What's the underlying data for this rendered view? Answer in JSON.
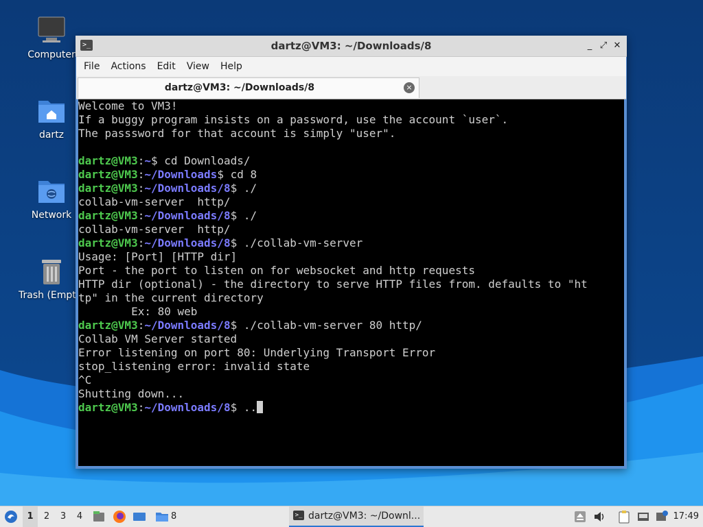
{
  "desktop": {
    "icons": [
      {
        "label": "Computer",
        "icon": "computer-icon"
      },
      {
        "label": "dartz",
        "icon": "home-folder-icon"
      },
      {
        "label": "Network",
        "icon": "network-folder-icon"
      },
      {
        "label": "Trash (Empty)",
        "icon": "trash-icon"
      }
    ]
  },
  "window": {
    "title": "dartz@VM3: ~/Downloads/8",
    "controls": {
      "minimize": "_",
      "maximize": "⤢",
      "close": "✕"
    }
  },
  "menu": [
    "File",
    "Actions",
    "Edit",
    "View",
    "Help"
  ],
  "tab": {
    "title": "dartz@VM3: ~/Downloads/8",
    "close": "×"
  },
  "terminal": {
    "lines": [
      [
        {
          "t": "Welcome to VM3!",
          "c": "c"
        }
      ],
      [
        {
          "t": "If a buggy program insists on a password, use the account `user`.",
          "c": "c"
        }
      ],
      [
        {
          "t": "The passsword for that account is simply \"user\".",
          "c": "c"
        }
      ],
      [
        {
          "t": "",
          "c": "c"
        }
      ],
      [
        {
          "t": "dartz@VM3",
          "c": "u"
        },
        {
          "t": ":",
          "c": "c"
        },
        {
          "t": "~",
          "c": "p"
        },
        {
          "t": "$ cd Downloads/",
          "c": "c"
        }
      ],
      [
        {
          "t": "dartz@VM3",
          "c": "u"
        },
        {
          "t": ":",
          "c": "c"
        },
        {
          "t": "~/Downloads",
          "c": "p"
        },
        {
          "t": "$ cd 8",
          "c": "c"
        }
      ],
      [
        {
          "t": "dartz@VM3",
          "c": "u"
        },
        {
          "t": ":",
          "c": "c"
        },
        {
          "t": "~/Downloads/8",
          "c": "p"
        },
        {
          "t": "$ ./",
          "c": "c"
        }
      ],
      [
        {
          "t": "collab-vm-server  http/",
          "c": "c"
        }
      ],
      [
        {
          "t": "dartz@VM3",
          "c": "u"
        },
        {
          "t": ":",
          "c": "c"
        },
        {
          "t": "~/Downloads/8",
          "c": "p"
        },
        {
          "t": "$ ./",
          "c": "c"
        }
      ],
      [
        {
          "t": "collab-vm-server  http/",
          "c": "c"
        }
      ],
      [
        {
          "t": "dartz@VM3",
          "c": "u"
        },
        {
          "t": ":",
          "c": "c"
        },
        {
          "t": "~/Downloads/8",
          "c": "p"
        },
        {
          "t": "$ ./collab-vm-server",
          "c": "c"
        }
      ],
      [
        {
          "t": "Usage: [Port] [HTTP dir]",
          "c": "c"
        }
      ],
      [
        {
          "t": "Port - the port to listen on for websocket and http requests",
          "c": "c"
        }
      ],
      [
        {
          "t": "HTTP dir (optional) - the directory to serve HTTP files from. defaults to \"ht",
          "c": "c"
        }
      ],
      [
        {
          "t": "tp\" in the current directory",
          "c": "c"
        }
      ],
      [
        {
          "t": "        Ex: 80 web",
          "c": "c"
        }
      ],
      [
        {
          "t": "dartz@VM3",
          "c": "u"
        },
        {
          "t": ":",
          "c": "c"
        },
        {
          "t": "~/Downloads/8",
          "c": "p"
        },
        {
          "t": "$ ./collab-vm-server 80 http/",
          "c": "c"
        }
      ],
      [
        {
          "t": "Collab VM Server started",
          "c": "c"
        }
      ],
      [
        {
          "t": "Error listening on port 80: Underlying Transport Error",
          "c": "c"
        }
      ],
      [
        {
          "t": "stop_listening error: invalid state",
          "c": "c"
        }
      ],
      [
        {
          "t": "^C",
          "c": "c"
        }
      ],
      [
        {
          "t": "Shutting down...",
          "c": "c"
        }
      ],
      [
        {
          "t": "dartz@VM3",
          "c": "u"
        },
        {
          "t": ":",
          "c": "c"
        },
        {
          "t": "~/Downloads/8",
          "c": "p"
        },
        {
          "t": "$ ..",
          "c": "c"
        }
      ]
    ]
  },
  "taskbar": {
    "workspaces": [
      "1",
      "2",
      "3",
      "4"
    ],
    "active_workspace": "1",
    "folder_launcher_label": "8",
    "task_label": "dartz@VM3: ~/Downl...",
    "clock": "17:49"
  },
  "colors": {
    "user_prompt": "#4ec94e",
    "path_prompt": "#7b7bff",
    "window_border": "#5a8fd3",
    "desktop_bg": "#0b3f7e"
  }
}
